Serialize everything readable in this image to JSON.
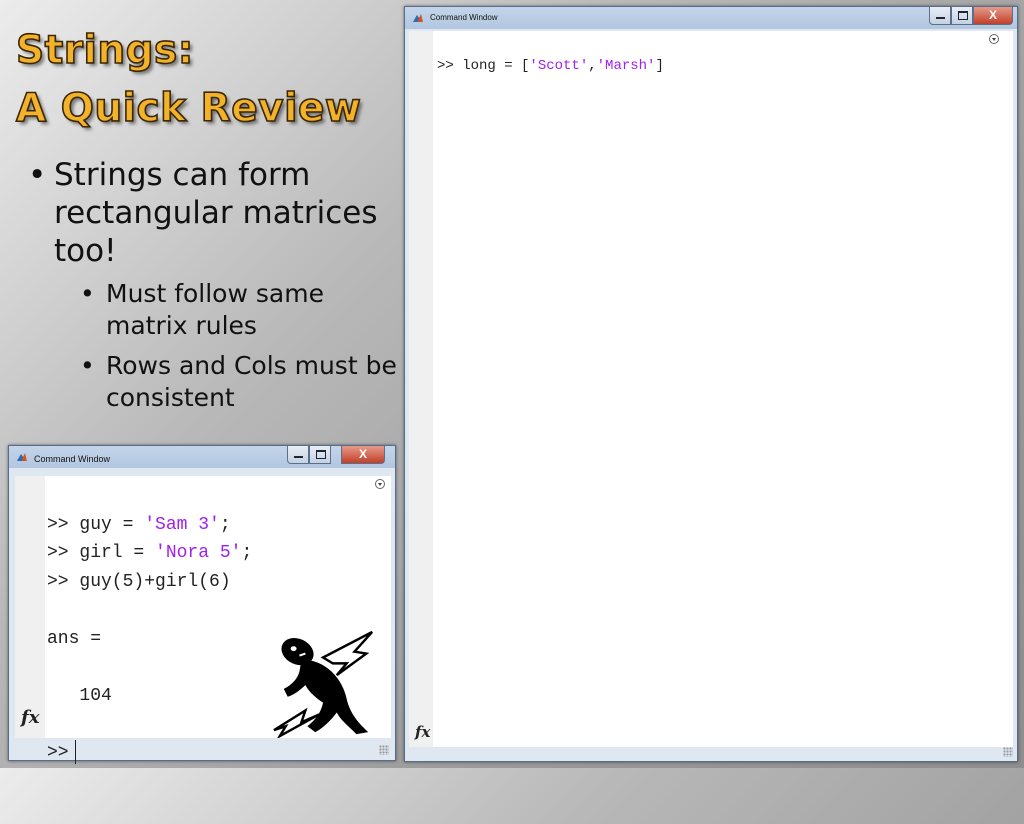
{
  "slide": {
    "title_line1": "Strings:",
    "title_line2": "A Quick Review",
    "bullet1": "Strings can form rectangular matrices too!",
    "sub1": "Must follow same matrix rules",
    "sub2": "Rows and Cols must be consistent",
    "bullet_char": "•"
  },
  "win_small": {
    "title": "Command Window",
    "close_label": "X",
    "line1_prompt": ">> guy = ",
    "line1_str": "'Sam 3'",
    "line1_end": ";",
    "line2_prompt": ">> girl = ",
    "line2_str": "'Nora 5'",
    "line2_end": ";",
    "line3": ">> guy(5)+girl(6)",
    "ans_label": "ans =",
    "ans_value": "104",
    "prompt": ">>",
    "fx_label": "fx"
  },
  "win_large": {
    "title": "Command Window",
    "close_label": "X",
    "line1_prompt": ">> long = [",
    "str1": "'Scott'",
    "comma": ",",
    "str2": "'Marsh'",
    "close_bracket": "]",
    "fx_label": "fx"
  },
  "colors": {
    "title": "#f2b32b",
    "string": "#a020f0",
    "close_button": "#c2402a"
  },
  "icons": [
    "matlab-logo-icon",
    "minimize-icon",
    "maximize-icon",
    "close-icon",
    "menu-chevron-icon",
    "resize-grip-icon",
    "shocked-person-icon"
  ]
}
